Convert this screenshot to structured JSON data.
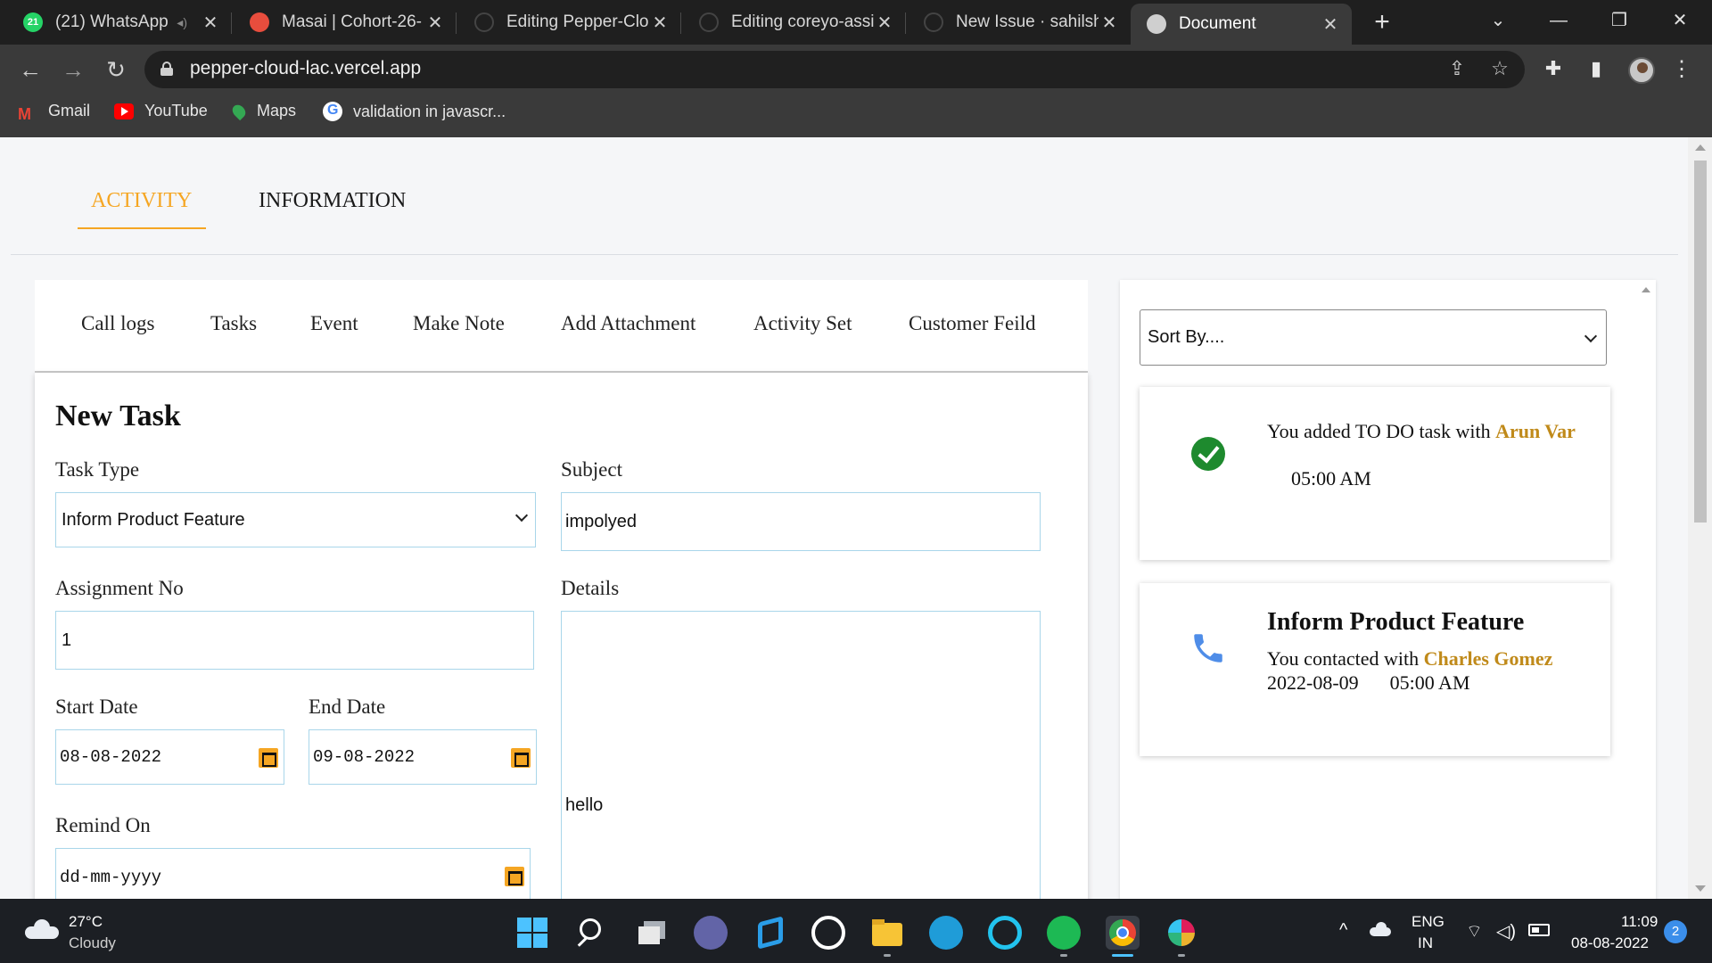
{
  "browser": {
    "tabs": [
      {
        "label": "(21) WhatsApp",
        "badge": "21",
        "favicon_color": "#25d366"
      },
      {
        "label": "Masai | Cohort-26-",
        "favicon_color": "#e84d3d"
      },
      {
        "label": "Editing Pepper-Clo",
        "favicon_color": "#1f1f1f"
      },
      {
        "label": "Editing coreyo-assi",
        "favicon_color": "#1f1f1f"
      },
      {
        "label": "New Issue · sahilshe",
        "favicon_color": "#1f1f1f"
      },
      {
        "label": "Document",
        "favicon_color": "#cfcfcf"
      }
    ],
    "url": "pepper-cloud-lac.vercel.app",
    "bookmarks": [
      "Gmail",
      "YouTube",
      "Maps",
      "validation in javascr..."
    ]
  },
  "page": {
    "top_tabs": [
      "ACTIVITY",
      "INFORMATION"
    ],
    "active_top_tab": "ACTIVITY",
    "sub_tabs": [
      "Call logs",
      "Tasks",
      "Event",
      "Make Note",
      "Add Attachment",
      "Activity Set",
      "Customer Feild"
    ],
    "form": {
      "title": "New Task",
      "task_type_label": "Task Type",
      "task_type_value": "Inform Product Feature",
      "subject_label": "Subject",
      "subject_value": "impolyed",
      "assignment_label": "Assignment No",
      "assignment_value": "1",
      "details_label": "Details",
      "details_value": "hello",
      "start_date_label": "Start Date",
      "start_date_value": "08-08-2022",
      "end_date_label": "End Date",
      "end_date_value": "09-08-2022",
      "remind_label": "Remind On",
      "remind_value": "dd-mm-yyyy"
    },
    "right_panel": {
      "sort_placeholder": "Sort By....",
      "activities": [
        {
          "type": "task",
          "prefix": "You added TO DO task with",
          "person": "Arun Var",
          "time": "05:00 AM"
        },
        {
          "type": "call",
          "title": "Inform Product Feature",
          "prefix": "You contacted with",
          "person": "Charles Gomez",
          "date": "2022-08-09",
          "time": "05:00 AM"
        }
      ]
    },
    "colors": {
      "accent": "#f5a623",
      "highlight": "#c08a1a",
      "success": "#1e8a2e",
      "phone": "#4f8de8"
    }
  },
  "taskbar": {
    "weather_temp": "27°C",
    "weather_desc": "Cloudy",
    "lang_top": "ENG",
    "lang_bottom": "IN",
    "time": "11:09",
    "date": "08-08-2022",
    "notifications": "2"
  }
}
